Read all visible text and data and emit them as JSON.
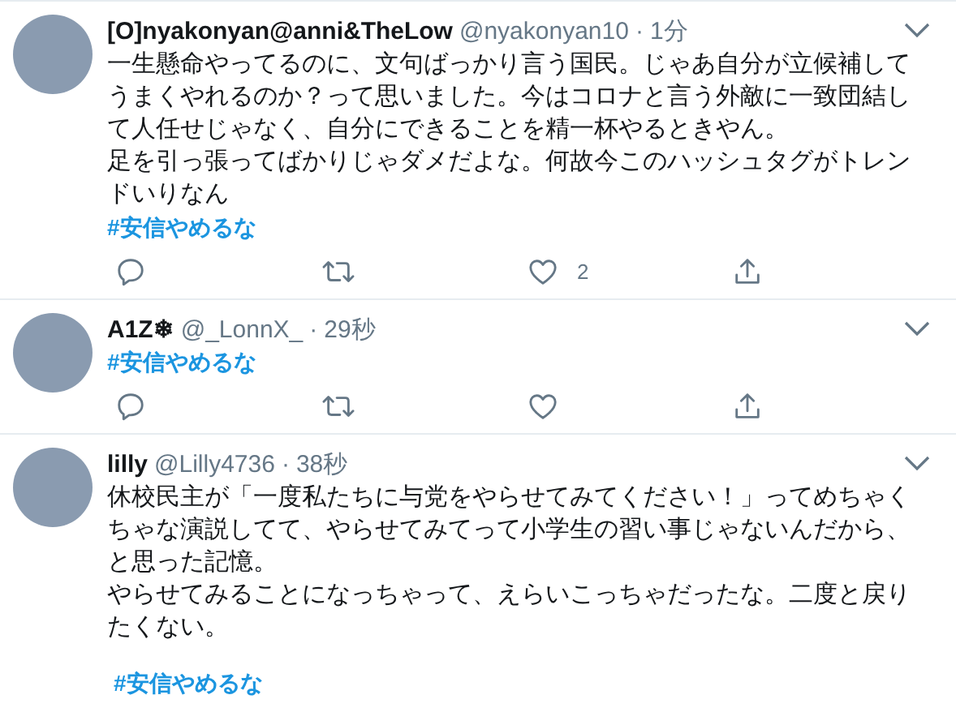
{
  "tweets": [
    {
      "display_name": "[O]nyakonyan@anni&TheLow",
      "handle": "@nyakonyan10",
      "separator": "·",
      "time": "1分",
      "paragraphs": [
        "一生懸命やってるのに、文句ばっかり言う国民。じゃあ自分が立候補してうまくやれるのか？って思いました。今はコロナと言う外敵に一致団結して人任せじゃなく、自分にできることを精一杯やるときやん。",
        "足を引っ張ってばかりじゃダメだよな。何故今このハッシュタグがトレンドいりなん"
      ],
      "hashtag": "#安信やめるな",
      "actions": [
        {
          "kind": "reply"
        },
        {
          "kind": "retweet"
        },
        {
          "kind": "like",
          "count": "2"
        },
        {
          "kind": "share"
        }
      ]
    },
    {
      "display_name": "A1Z❄",
      "handle": "@_LonnX_",
      "separator": "·",
      "time": "29秒",
      "hashtag": "#安信やめるな",
      "actions": [
        {
          "kind": "reply"
        },
        {
          "kind": "retweet"
        },
        {
          "kind": "like"
        },
        {
          "kind": "share"
        }
      ]
    },
    {
      "display_name": "lilly",
      "handle": "@Lilly4736",
      "separator": "·",
      "time": "38秒",
      "paragraphs": [
        "休校民主が「一度私たちに与党をやらせてみてください！」ってめちゃくちゃな演説してて、やらせてみてって小学生の習い事じゃないんだから、と思った記憶。",
        "やらせてみることになっちゃって、えらいこっちゃだったな。二度と戻りたくない。"
      ],
      "hashtag": "#安信やめるな",
      "hashtag_gap": true
    }
  ]
}
